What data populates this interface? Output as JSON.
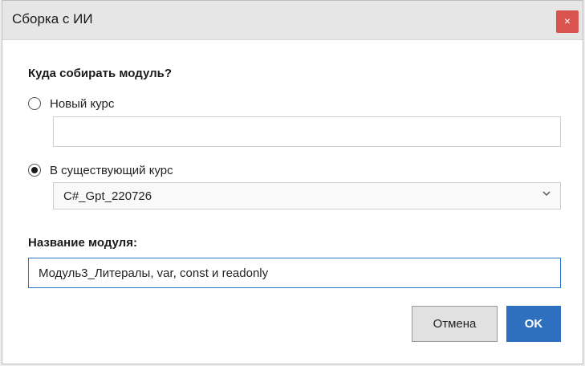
{
  "dialog": {
    "title": "Сборка с ИИ",
    "close_label": "×"
  },
  "target": {
    "heading": "Куда собирать модуль?",
    "options": [
      {
        "label": "Новый курс",
        "selected": false
      },
      {
        "label": "В существующий курс",
        "selected": true
      }
    ],
    "new_course_value": "",
    "existing_course_selected": "C#_Gpt_220726"
  },
  "module": {
    "heading": "Название модуля:",
    "name_value": "Модуль3_Литералы, var, const и readonly"
  },
  "buttons": {
    "cancel": "Отмена",
    "ok": "OK"
  },
  "colors": {
    "close_bg": "#d9534f",
    "ok_bg": "#2e6fc0",
    "focus_border": "#2e77c7"
  },
  "icons": {
    "dropdown": "chevron-down-icon"
  }
}
